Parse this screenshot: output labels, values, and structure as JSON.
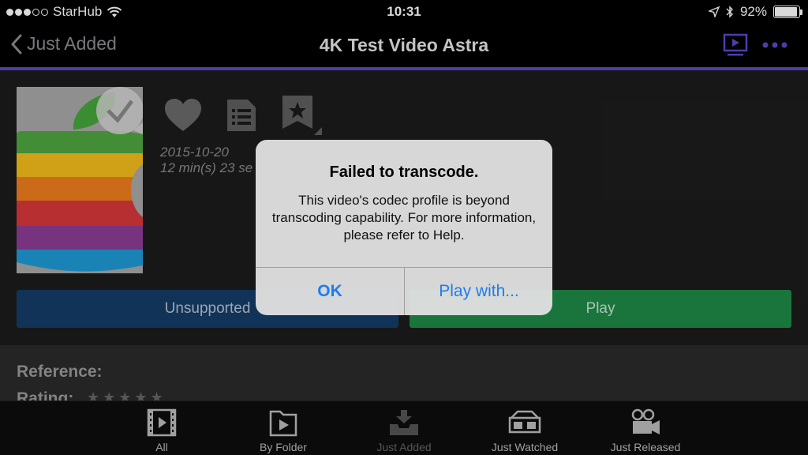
{
  "status_bar": {
    "carrier": "StarHub",
    "time": "10:31",
    "battery": "92%",
    "battery_level": 0.92
  },
  "nav": {
    "back_label": "Just Added",
    "title": "4K Test Video Astra"
  },
  "video": {
    "date": "2015-10-20",
    "duration": "12 min(s) 23 se"
  },
  "buttons": {
    "unsupported": "Unsupported",
    "play": "Play"
  },
  "details": {
    "reference_label": "Reference:",
    "rating_label": "Rating:",
    "rating_stars": "★★★★★"
  },
  "tabs": [
    {
      "label": "All",
      "icon": "film-icon"
    },
    {
      "label": "By Folder",
      "icon": "folder-play-icon"
    },
    {
      "label": "Just Added",
      "icon": "inbox-download-icon"
    },
    {
      "label": "Just Watched",
      "icon": "3d-glasses-icon"
    },
    {
      "label": "Just Released",
      "icon": "movie-camera-icon"
    }
  ],
  "alert": {
    "title": "Failed to transcode.",
    "message": "This video's codec profile is beyond transcoding capability. For more information, please refer to Help.",
    "ok_label": "OK",
    "play_with_label": "Play with..."
  },
  "colors": {
    "accent": "#5b48c8",
    "ios_blue": "#1e7cf0",
    "play_green": "#1f8a47",
    "unsupported_blue": "#143c67"
  }
}
